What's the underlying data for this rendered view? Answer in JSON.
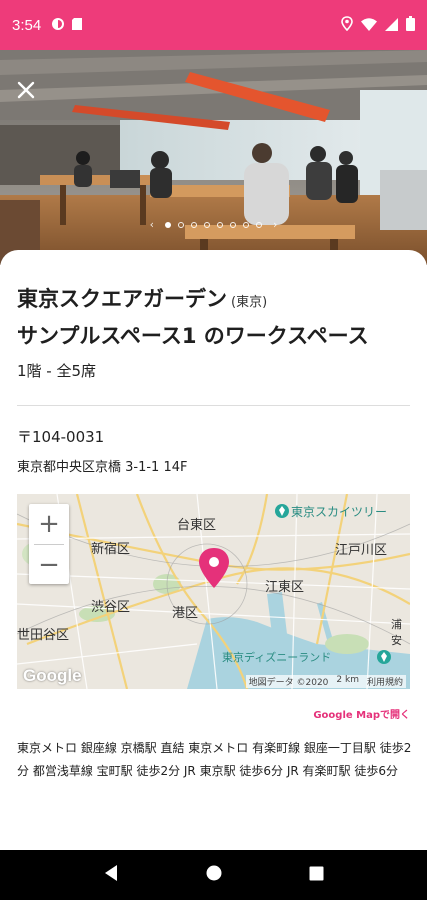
{
  "status": {
    "time": "3:54",
    "bar_color": "#ee3b7a"
  },
  "hero": {
    "page_count": 8,
    "active_index": 0
  },
  "space": {
    "title": "東京スクエアガーデン",
    "title_tag": "(東京)",
    "subtitle": "サンプルスペース1 のワークスペース",
    "floor": "1階 - 全5席"
  },
  "address": {
    "postal": "〒104-0031",
    "street": "東京都中央区京橋 3-1-1 14F"
  },
  "map": {
    "labels": {
      "taito": "台東区",
      "skytree": "東京スカイツリー",
      "shinjuku": "新宿区",
      "edogawa": "江戸川区",
      "koto": "江東区",
      "shibuya": "渋谷区",
      "minato": "港区",
      "setagaya": "世田谷区",
      "disney": "東京ディズニーランド",
      "urayasu": "浦安"
    },
    "google": "Google",
    "attribution": "地図データ ©2020",
    "scale": "2 km",
    "terms": "利用規約",
    "zoom_in": "+",
    "zoom_out": "−",
    "pin_color": "#e5317a"
  },
  "open_map_label": "Google Mapで開く",
  "access_text": "東京メトロ 銀座線 京橋駅 直結 東京メトロ 有楽町線 銀座一丁目駅 徒歩2分 都営浅草線 宝町駅 徒歩2分 JR 東京駅 徒歩6分 JR 有楽町駅 徒歩6分"
}
